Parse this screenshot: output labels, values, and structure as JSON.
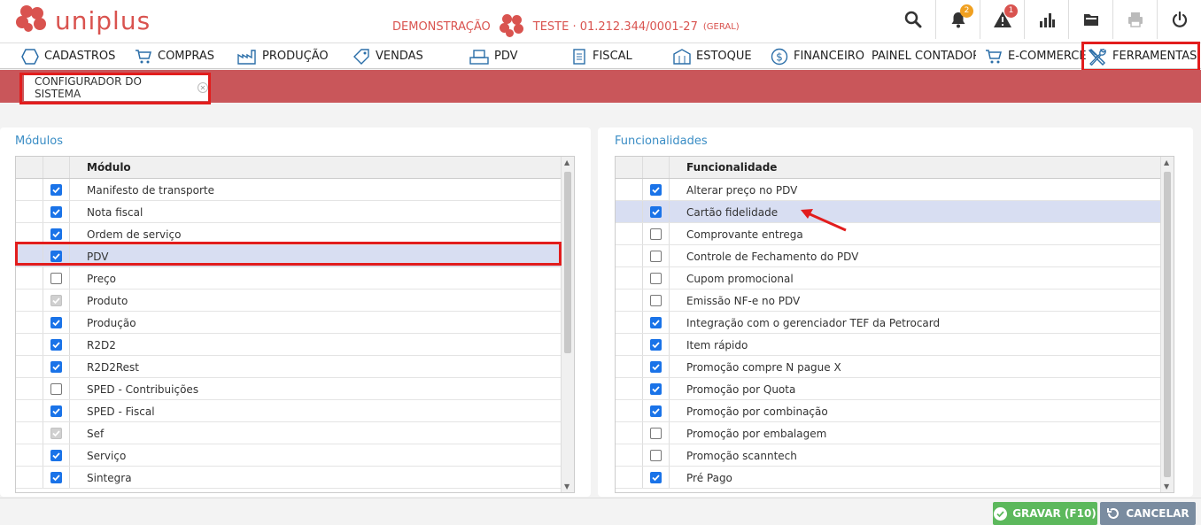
{
  "app": {
    "brand": "uniplus"
  },
  "company": {
    "mode": "DEMONSTRAÇÃO",
    "name": "TESTE · 01.212.344/0001-27",
    "type": "(GERAL)"
  },
  "toolbar": {
    "notifications_badge": "2",
    "alerts_badge": "1"
  },
  "menu": [
    {
      "label": "CADASTROS",
      "icon": "hexagon-icon"
    },
    {
      "label": "COMPRAS",
      "icon": "cart-icon"
    },
    {
      "label": "PRODUÇÃO",
      "icon": "factory-icon"
    },
    {
      "label": "VENDAS",
      "icon": "tag-icon"
    },
    {
      "label": "PDV",
      "icon": "register-icon"
    },
    {
      "label": "FISCAL",
      "icon": "document-icon"
    },
    {
      "label": "ESTOQUE",
      "icon": "warehouse-icon"
    },
    {
      "label": "FINANCEIRO",
      "icon": "dollar-icon"
    },
    {
      "label": "PAINEL CONTADOR",
      "icon": "clipboard-icon"
    },
    {
      "label": "E-COMMERCE",
      "icon": "cart-icon"
    },
    {
      "label": "FERRAMENTAS",
      "icon": "tools-icon"
    }
  ],
  "tab": {
    "label": "CONFIGURADOR DO SISTEMA"
  },
  "modulos": {
    "title": "Módulos",
    "column": "Módulo",
    "rows": [
      {
        "label": "Manifesto de transporte",
        "state": "checked"
      },
      {
        "label": "Nota fiscal",
        "state": "checked"
      },
      {
        "label": "Ordem de serviço",
        "state": "checked"
      },
      {
        "label": "PDV",
        "state": "checked",
        "selected": true
      },
      {
        "label": "Preço",
        "state": "unchecked"
      },
      {
        "label": "Produto",
        "state": "disabled"
      },
      {
        "label": "Produção",
        "state": "checked"
      },
      {
        "label": "R2D2",
        "state": "checked"
      },
      {
        "label": "R2D2Rest",
        "state": "checked"
      },
      {
        "label": "SPED - Contribuições",
        "state": "unchecked"
      },
      {
        "label": "SPED - Fiscal",
        "state": "checked"
      },
      {
        "label": "Sef",
        "state": "disabled"
      },
      {
        "label": "Serviço",
        "state": "checked"
      },
      {
        "label": "Sintegra",
        "state": "checked"
      }
    ]
  },
  "funcionalidades": {
    "title": "Funcionalidades",
    "column": "Funcionalidade",
    "rows": [
      {
        "label": "Alterar preço no PDV",
        "state": "checked"
      },
      {
        "label": "Cartão fidelidade",
        "state": "checked",
        "selected": true
      },
      {
        "label": "Comprovante entrega",
        "state": "unchecked"
      },
      {
        "label": "Controle de Fechamento do PDV",
        "state": "unchecked"
      },
      {
        "label": "Cupom promocional",
        "state": "unchecked"
      },
      {
        "label": "Emissão NF-e no PDV",
        "state": "unchecked"
      },
      {
        "label": "Integração com o gerenciador TEF da Petrocard",
        "state": "checked"
      },
      {
        "label": "Item rápido",
        "state": "checked"
      },
      {
        "label": "Promoção compre N pague X",
        "state": "checked"
      },
      {
        "label": "Promoção por Quota",
        "state": "checked"
      },
      {
        "label": "Promoção por combinação",
        "state": "checked"
      },
      {
        "label": "Promoção por embalagem",
        "state": "unchecked"
      },
      {
        "label": "Promoção scanntech",
        "state": "unchecked"
      },
      {
        "label": "Pré Pago",
        "state": "checked"
      }
    ]
  },
  "actions": {
    "save": "GRAVAR (F10)",
    "cancel": "CANCELAR"
  },
  "colors": {
    "brand": "#d9534f",
    "band": "#c9565a",
    "accent": "#3a8dc5",
    "save": "#5cb85c",
    "cancel": "#7a8ca0",
    "highlight": "#e21d1d"
  }
}
